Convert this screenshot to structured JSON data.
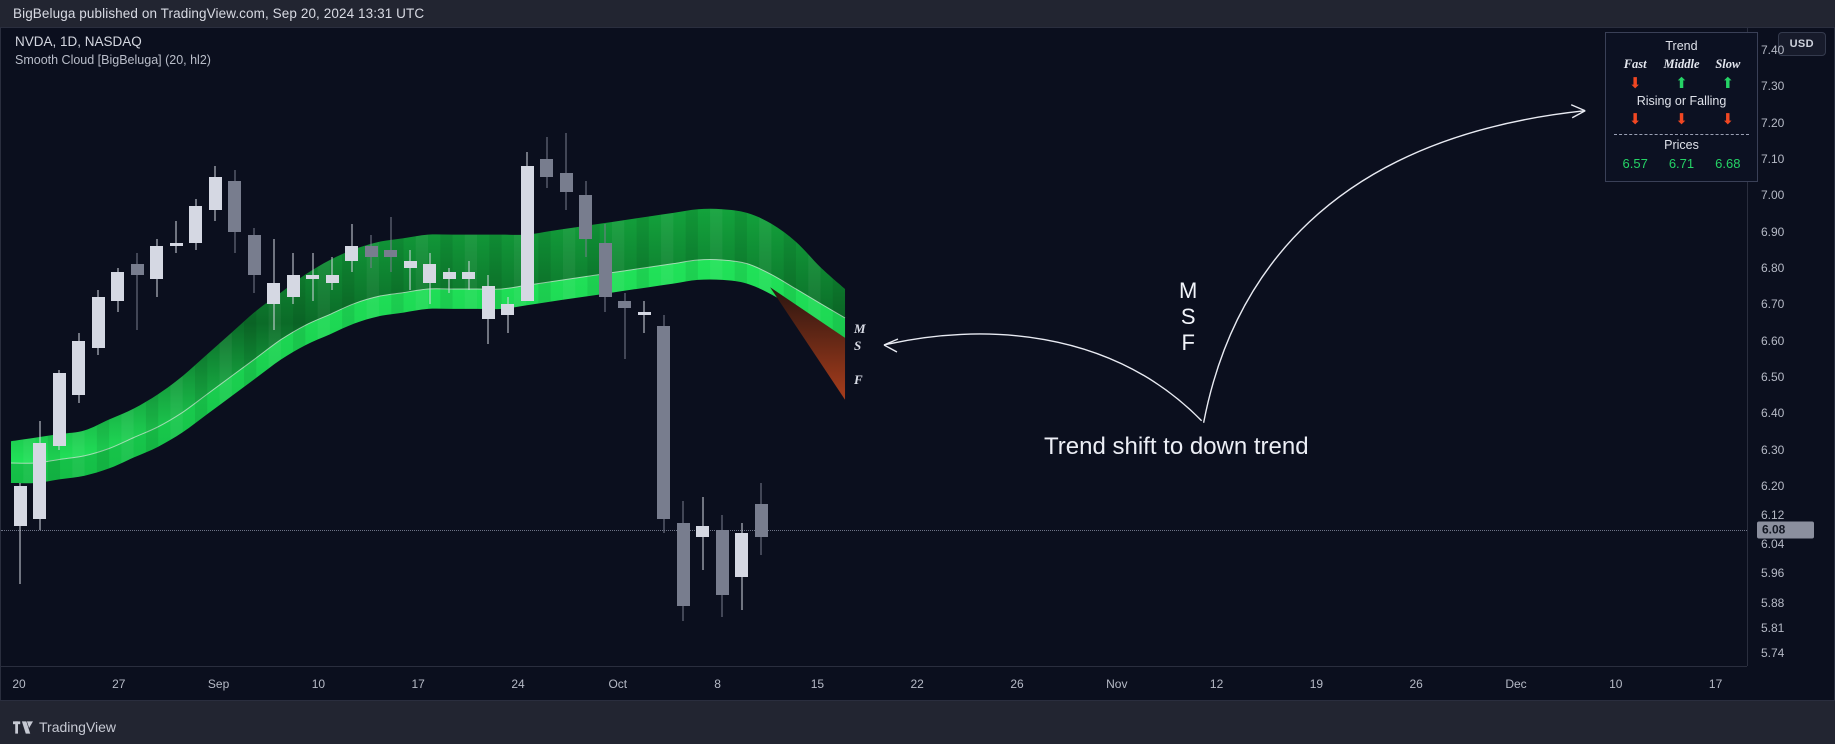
{
  "header": {
    "publish_text": "BigBeluga published on TradingView.com, Sep 20, 2024 13:31 UTC"
  },
  "legend": {
    "symbol_line": "NVDA, 1D, NASDAQ",
    "indicator_line": "Smooth Cloud [BigBeluga] (20, hl2)"
  },
  "price_axis": {
    "currency_badge": "USD",
    "current_price": "6.08",
    "ticks": [
      "7.40",
      "7.30",
      "7.20",
      "7.10",
      "7.00",
      "6.90",
      "6.80",
      "6.70",
      "6.60",
      "6.50",
      "6.40",
      "6.30",
      "6.20",
      "6.12",
      "6.04",
      "5.96",
      "5.88",
      "5.81",
      "5.74"
    ]
  },
  "time_axis": {
    "ticks": [
      "20",
      "27",
      "Sep",
      "10",
      "17",
      "24",
      "Oct",
      "8",
      "15",
      "22",
      "26",
      "Nov",
      "12",
      "19",
      "26",
      "Dec",
      "10",
      "17"
    ]
  },
  "cloud_labels": {
    "middle": "M",
    "slow": "S",
    "fast": "F"
  },
  "annotations": {
    "msf_stack": "M\nS\nF",
    "msf_m": "M",
    "msf_s": "S",
    "msf_f": "F",
    "caption": "Trend shift to down trend"
  },
  "trend_panel": {
    "title": "Trend",
    "headers": [
      "Fast",
      "Middle",
      "Slow"
    ],
    "trend_arrows": [
      "down",
      "up",
      "up"
    ],
    "subtitle": "Rising or Falling",
    "rising_falling_arrows": [
      "down",
      "down",
      "down"
    ],
    "prices_title": "Prices",
    "prices": [
      "6.57",
      "6.71",
      "6.68"
    ],
    "arrow_glyph_up": "⬆",
    "arrow_glyph_down": "⬇"
  },
  "brand": {
    "name": "TradingView"
  },
  "colors": {
    "background": "#0b0f1e",
    "chrome": "#222531",
    "up_candle": "#d5d8e3",
    "down_candle": "#787d8e",
    "cloud_green": "#1fd04f",
    "cloud_red": "#8a3520",
    "arrow_up": "#25d366",
    "arrow_down": "#f14722",
    "text": "#d8dae3"
  },
  "chart_data": {
    "type": "candlestick",
    "title": "NVDA, 1D, NASDAQ — Smooth Cloud [BigBeluga] (20, hl2)",
    "xlabel": "",
    "ylabel": "USD",
    "ylim": [
      5.7,
      7.46
    ],
    "grid": false,
    "legend_position": "top-left",
    "x_tick_labels": [
      "20",
      "27",
      "Sep",
      "10",
      "17",
      "24",
      "Oct",
      "8",
      "15",
      "22",
      "26",
      "Nov",
      "12",
      "19",
      "26",
      "Dec",
      "10",
      "17"
    ],
    "y_tick_labels": [
      "7.40",
      "7.30",
      "7.20",
      "7.10",
      "7.00",
      "6.90",
      "6.80",
      "6.70",
      "6.60",
      "6.50",
      "6.40",
      "6.30",
      "6.20",
      "6.12",
      "6.04",
      "5.96",
      "5.88",
      "5.81",
      "5.74"
    ],
    "current_price": 6.08,
    "candles": [
      {
        "o": 6.2,
        "h": 6.21,
        "l": 5.93,
        "c": 6.09,
        "d": "up"
      },
      {
        "o": 6.11,
        "h": 6.38,
        "l": 6.08,
        "c": 6.32,
        "d": "up"
      },
      {
        "o": 6.31,
        "h": 6.52,
        "l": 6.3,
        "c": 6.51,
        "d": "up"
      },
      {
        "o": 6.45,
        "h": 6.62,
        "l": 6.43,
        "c": 6.6,
        "d": "up"
      },
      {
        "o": 6.58,
        "h": 6.74,
        "l": 6.56,
        "c": 6.72,
        "d": "up"
      },
      {
        "o": 6.71,
        "h": 6.8,
        "l": 6.68,
        "c": 6.79,
        "d": "up"
      },
      {
        "o": 6.81,
        "h": 6.84,
        "l": 6.63,
        "c": 6.78,
        "d": "down"
      },
      {
        "o": 6.77,
        "h": 6.88,
        "l": 6.72,
        "c": 6.86,
        "d": "up"
      },
      {
        "o": 6.86,
        "h": 6.93,
        "l": 6.84,
        "c": 6.87,
        "d": "up"
      },
      {
        "o": 6.87,
        "h": 6.99,
        "l": 6.85,
        "c": 6.97,
        "d": "up"
      },
      {
        "o": 6.96,
        "h": 7.08,
        "l": 6.93,
        "c": 7.05,
        "d": "up"
      },
      {
        "o": 7.04,
        "h": 7.07,
        "l": 6.84,
        "c": 6.9,
        "d": "down"
      },
      {
        "o": 6.89,
        "h": 6.91,
        "l": 6.73,
        "c": 6.78,
        "d": "down"
      },
      {
        "o": 6.76,
        "h": 6.88,
        "l": 6.63,
        "c": 6.7,
        "d": "up"
      },
      {
        "o": 6.72,
        "h": 6.84,
        "l": 6.7,
        "c": 6.78,
        "d": "up"
      },
      {
        "o": 6.78,
        "h": 6.84,
        "l": 6.71,
        "c": 6.77,
        "d": "up"
      },
      {
        "o": 6.76,
        "h": 6.83,
        "l": 6.74,
        "c": 6.78,
        "d": "up"
      },
      {
        "o": 6.82,
        "h": 6.92,
        "l": 6.79,
        "c": 6.86,
        "d": "up"
      },
      {
        "o": 6.86,
        "h": 6.89,
        "l": 6.8,
        "c": 6.83,
        "d": "down"
      },
      {
        "o": 6.83,
        "h": 6.94,
        "l": 6.79,
        "c": 6.85,
        "d": "down"
      },
      {
        "o": 6.82,
        "h": 6.85,
        "l": 6.74,
        "c": 6.8,
        "d": "up"
      },
      {
        "o": 6.81,
        "h": 6.84,
        "l": 6.7,
        "c": 6.76,
        "d": "up"
      },
      {
        "o": 6.77,
        "h": 6.8,
        "l": 6.73,
        "c": 6.79,
        "d": "up"
      },
      {
        "o": 6.79,
        "h": 6.82,
        "l": 6.74,
        "c": 6.77,
        "d": "up"
      },
      {
        "o": 6.75,
        "h": 6.78,
        "l": 6.59,
        "c": 6.66,
        "d": "up"
      },
      {
        "o": 6.67,
        "h": 6.72,
        "l": 6.62,
        "c": 6.7,
        "d": "up"
      },
      {
        "o": 6.71,
        "h": 7.12,
        "l": 6.88,
        "c": 7.08,
        "d": "up"
      },
      {
        "o": 7.1,
        "h": 7.16,
        "l": 7.02,
        "c": 7.05,
        "d": "down"
      },
      {
        "o": 7.06,
        "h": 7.17,
        "l": 6.96,
        "c": 7.01,
        "d": "down"
      },
      {
        "o": 7.0,
        "h": 7.04,
        "l": 6.83,
        "c": 6.88,
        "d": "down"
      },
      {
        "o": 6.87,
        "h": 6.92,
        "l": 6.68,
        "c": 6.72,
        "d": "down"
      },
      {
        "o": 6.71,
        "h": 6.73,
        "l": 6.55,
        "c": 6.69,
        "d": "down"
      },
      {
        "o": 6.68,
        "h": 6.71,
        "l": 6.62,
        "c": 6.67,
        "d": "up"
      },
      {
        "o": 6.64,
        "h": 6.67,
        "l": 6.07,
        "c": 6.11,
        "d": "down"
      },
      {
        "o": 6.1,
        "h": 6.16,
        "l": 5.83,
        "c": 5.87,
        "d": "down"
      },
      {
        "o": 6.06,
        "h": 6.17,
        "l": 5.97,
        "c": 6.09,
        "d": "up"
      },
      {
        "o": 6.08,
        "h": 6.12,
        "l": 5.84,
        "c": 5.9,
        "d": "down"
      },
      {
        "o": 5.95,
        "h": 6.1,
        "l": 5.86,
        "c": 6.07,
        "d": "up"
      },
      {
        "o": 6.06,
        "h": 6.21,
        "l": 6.01,
        "c": 6.15,
        "d": "down"
      }
    ],
    "cloud": {
      "name": "Smooth Cloud [BigBeluga]",
      "length": 20,
      "source": "hl2",
      "trend": "bullish-to-bearish",
      "upper_band": [
        6.32,
        6.33,
        6.34,
        6.35,
        6.38,
        6.41,
        6.45,
        6.5,
        6.56,
        6.62,
        6.68,
        6.73,
        6.78,
        6.82,
        6.85,
        6.87,
        6.88,
        6.89,
        6.89,
        6.89,
        6.89,
        6.89,
        6.9,
        6.91,
        6.92,
        6.93,
        6.94,
        6.95,
        6.96,
        6.96,
        6.95,
        6.92,
        6.87,
        6.8,
        6.74
      ],
      "lower_band": [
        6.26,
        6.26,
        6.27,
        6.28,
        6.3,
        6.33,
        6.36,
        6.4,
        6.45,
        6.5,
        6.55,
        6.6,
        6.64,
        6.67,
        6.7,
        6.72,
        6.73,
        6.74,
        6.74,
        6.74,
        6.74,
        6.75,
        6.76,
        6.77,
        6.78,
        6.79,
        6.8,
        6.81,
        6.82,
        6.82,
        6.81,
        6.78,
        6.74,
        6.7,
        6.66
      ]
    }
  }
}
